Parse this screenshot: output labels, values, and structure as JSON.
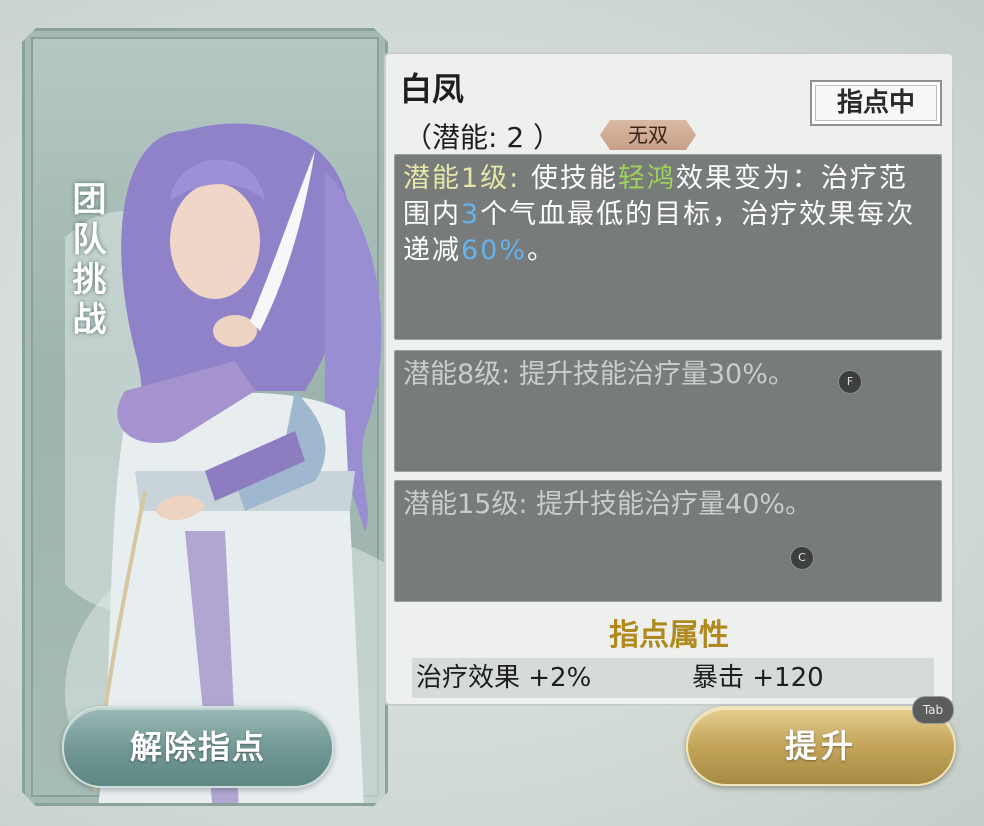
{
  "portrait": {
    "vertical_label": "团队挑战",
    "release_button": "解除指点"
  },
  "hero": {
    "name": "白凤",
    "guide_tag": "指点中",
    "potential_line": "（潜能: 2 ）",
    "badge": "无双"
  },
  "skills": [
    {
      "label": "潜能1级:",
      "text_a": " 使技能",
      "skill_name": "轻鸿",
      "text_b": "效果变为：治疗范围内",
      "num_a": "3",
      "text_c": "个气血最低的目标，治疗效果每次递减",
      "num_b": "60%",
      "text_d": "。"
    },
    {
      "text": "潜能8级: 提升技能治疗量30%。"
    },
    {
      "text": "潜能15级: 提升技能治疗量40%。"
    }
  ],
  "key_hints": {
    "f": "F",
    "c": "C",
    "tab": "Tab"
  },
  "attributes": {
    "title": "指点属性",
    "heal": "治疗效果 +2%",
    "crit": "暴击 +120"
  },
  "actions": {
    "upgrade": "提升"
  },
  "colors": {
    "accent_gold": "#b08a1e",
    "skill_green": "#9fd25c",
    "number_blue": "#63b3ee",
    "button_teal": "#6f9693",
    "button_gold": "#c3a45a"
  }
}
